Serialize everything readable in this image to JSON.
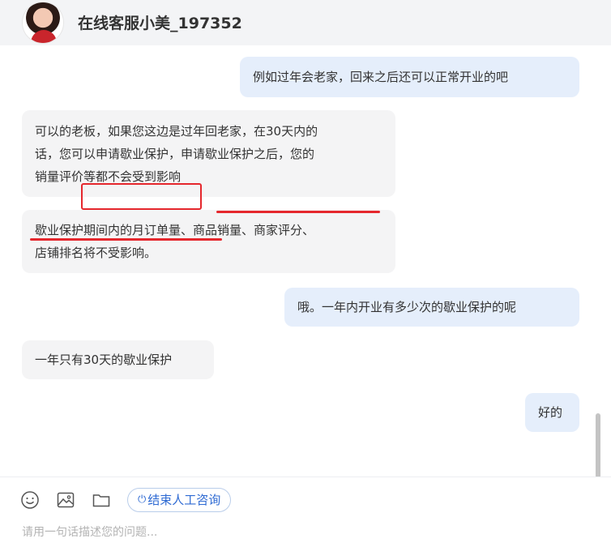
{
  "header": {
    "agent_name": "在线客服小美_197352"
  },
  "messages": [
    {
      "role": "user",
      "lines": [
        "例如过年会老家，回来之后还可以正常开业的吧"
      ]
    },
    {
      "role": "agent",
      "lines": [
        "可以的老板，如果您这边是过年回老家，在30天内的",
        "话，您可以申请歇业保护，申请歇业保护之后，您的",
        "销量评价等都不会受到影响"
      ]
    },
    {
      "role": "agent",
      "lines": [
        "歇业保护期间内的月订单量、商品销量、商家评分、",
        "店铺排名将不受影响。"
      ]
    },
    {
      "role": "user",
      "lines": [
        "哦。一年内开业有多少次的歇业保护的呢"
      ]
    },
    {
      "role": "agent",
      "lines": [
        "一年只有30天的歇业保护"
      ]
    },
    {
      "role": "user",
      "lines": [
        "好的"
      ]
    }
  ],
  "composer": {
    "end_button_label": "结束人工咨询",
    "input_placeholder": "请用一句话描述您的问题...",
    "input_value": ""
  },
  "colors": {
    "user_bubble": "#e5eefb",
    "agent_bubble": "#f4f4f5",
    "annotation": "#e5272d",
    "accent": "#2f6bd3"
  }
}
